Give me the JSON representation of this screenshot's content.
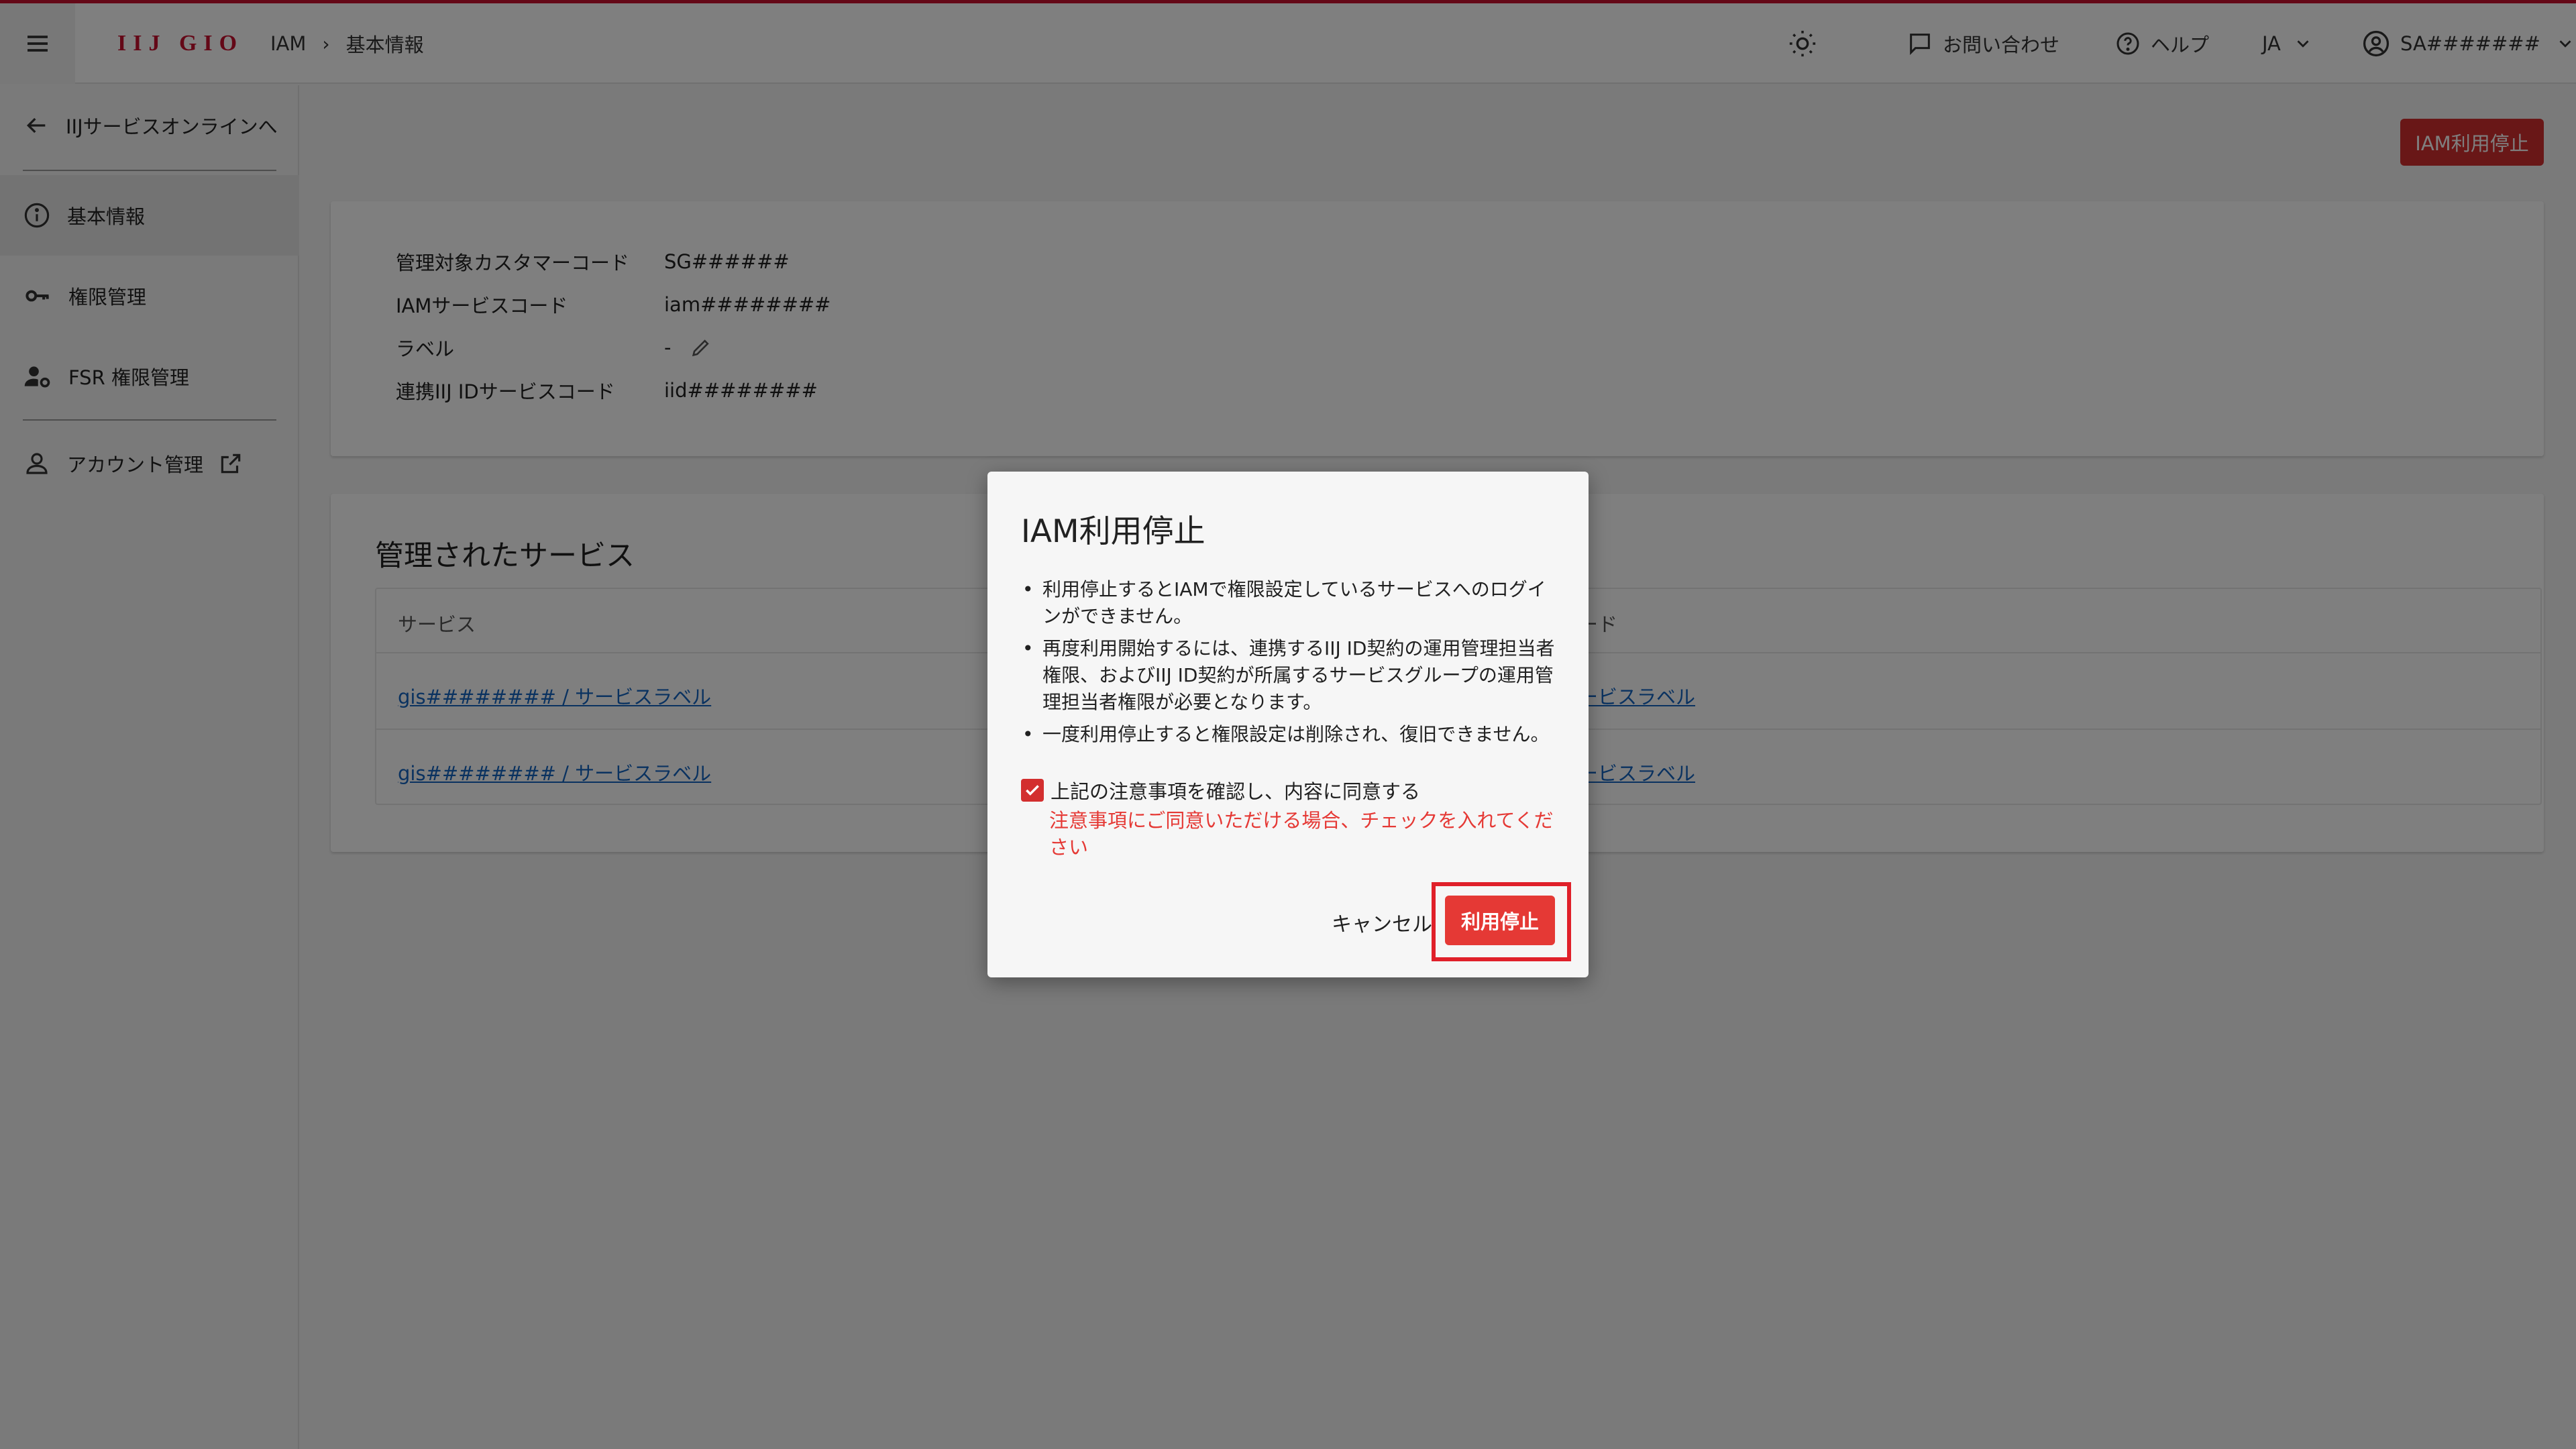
{
  "header": {
    "logo": "IIJ GIO",
    "breadcrumb": [
      "IAM",
      "基本情報"
    ],
    "breadcrumb_separator": "›",
    "contact": "お問い合わせ",
    "help": "ヘルプ",
    "language": "JA",
    "account": "SA#######"
  },
  "sidebar": {
    "back": "IIJサービスオンラインへ",
    "items": [
      {
        "label": "基本情報",
        "icon": "info-icon",
        "active": true
      },
      {
        "label": "権限管理",
        "icon": "key-icon"
      },
      {
        "label": "FSR 権限管理",
        "icon": "user-gear-icon"
      },
      {
        "label": "アカウント管理",
        "icon": "person-icon",
        "external": true
      }
    ]
  },
  "main": {
    "stop_button": "IAM利用停止",
    "info": [
      {
        "label": "管理対象カスタマーコード",
        "value": "SG######"
      },
      {
        "label": "IAMサービスコード",
        "value": "iam########"
      },
      {
        "label": "ラベル",
        "value": "-"
      },
      {
        "label": "連携IIJ IDサービスコード",
        "value": "iid########"
      }
    ],
    "services": {
      "title": "管理されたサービス",
      "columns": [
        "サービス",
        "ード"
      ],
      "rows": [
        {
          "service": "gis######## / サービスラベル",
          "other": "ービスラベル"
        },
        {
          "service": "gis######## / サービスラベル",
          "other": "ービスラベル"
        }
      ]
    }
  },
  "dialog": {
    "title": "IAM利用停止",
    "notes": [
      "利用停止するとIAMで権限設定しているサービスへのログインができません。",
      "再度利用開始するには、連携するIIJ ID契約の運用管理担当者権限、およびIIJ ID契約が所属するサービスグループの運用管理担当者権限が必要となります。",
      "一度利用停止すると権限設定は削除され、復旧できません。"
    ],
    "agree_label": "上記の注意事項を確認し、内容に同意する",
    "agree_checked": true,
    "error": "注意事項にご同意いただける場合、チェックを入れてください",
    "cancel": "キャンセル",
    "confirm": "利用停止"
  },
  "colors": {
    "brand": "#c8102e",
    "danger": "#d32f2f",
    "link": "#1565c0",
    "error_text": "#e53935"
  }
}
